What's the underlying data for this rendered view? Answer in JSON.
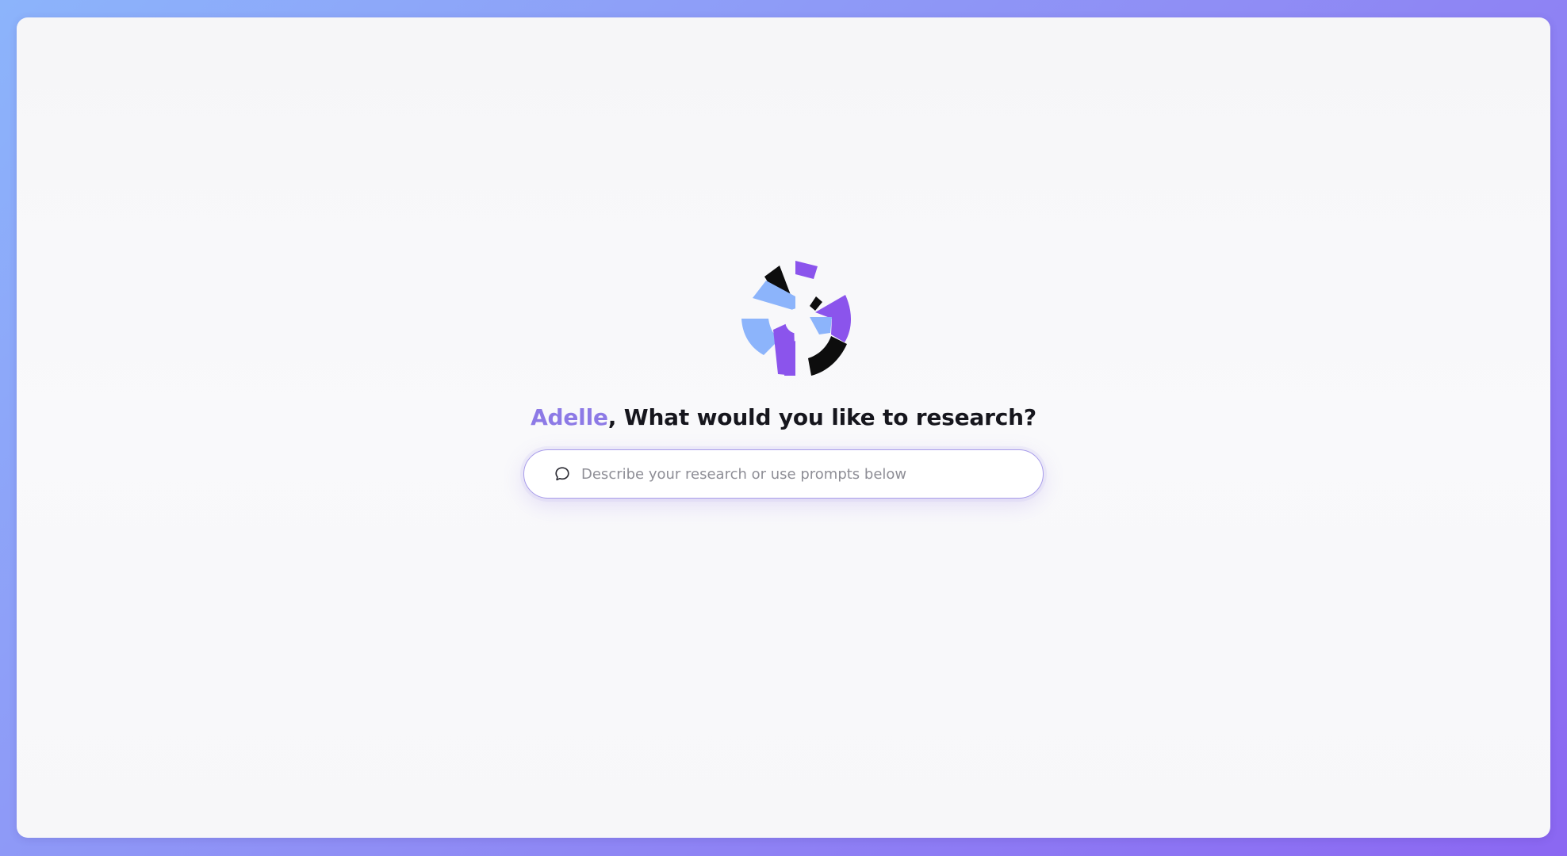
{
  "greeting": {
    "name": "Adelle",
    "text": ", What would you like to research?"
  },
  "search": {
    "placeholder": "Describe your research or use prompts below"
  },
  "icons": {
    "logo": "radial-burst-logo",
    "search": "speech-bubble-icon"
  },
  "colors": {
    "accent": "#8d7ae6",
    "logo_purple": "#8b54ec",
    "logo_blue": "#8cb4fb",
    "logo_black": "#0d0d0d"
  }
}
